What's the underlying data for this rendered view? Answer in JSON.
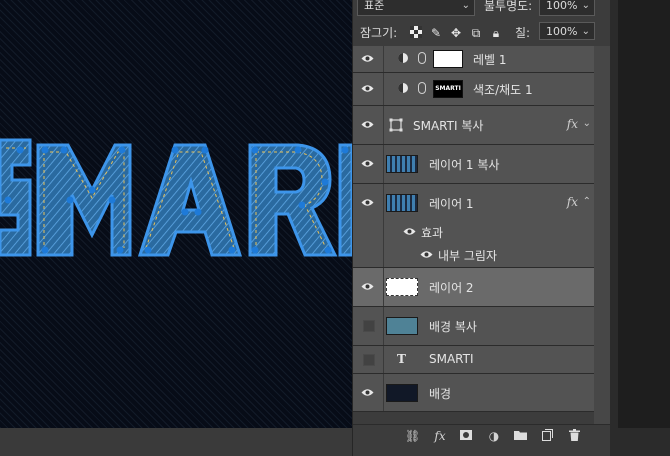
{
  "canvas": {
    "artwork_text": "MARTI"
  },
  "panel": {
    "blend_mode": "표준",
    "opacity_label": "불투명도:",
    "opacity_value": "100%",
    "lock_label": "잠그기:",
    "fill_label": "칠:",
    "fill_value": "100%"
  },
  "layers": [
    {
      "name": "레벨 1",
      "type": "adjustment",
      "icon": "levels-adjustment-icon",
      "mask_text": ""
    },
    {
      "name": "색조/채도 1",
      "type": "adjustment",
      "icon": "hue-saturation-adjustment-icon",
      "mask_text": "SMARTI"
    },
    {
      "name": "SMARTI 복사",
      "type": "smart",
      "fx": "fx"
    },
    {
      "name": "레이어 1 복사",
      "type": "pixel"
    },
    {
      "name": "레이어 1",
      "type": "pixel",
      "fx": "fx"
    },
    {
      "name": "효과",
      "type": "effect-group"
    },
    {
      "name": "내부 그림자",
      "type": "effect"
    },
    {
      "name": "레이어 2",
      "type": "pixel",
      "selected": true
    },
    {
      "name": "배경 복사",
      "type": "pixel",
      "visible": false
    },
    {
      "name": "SMARTI",
      "type": "text",
      "visible": false,
      "type_glyph": "T"
    },
    {
      "name": "배경",
      "type": "pixel"
    }
  ],
  "colors": {
    "panel_bg": "#3c3c3c",
    "row_bg": "#535353",
    "row_selected": "#6a6a6a",
    "canvas_bg": "#070c17",
    "denim_blue": "#2e86d6"
  }
}
